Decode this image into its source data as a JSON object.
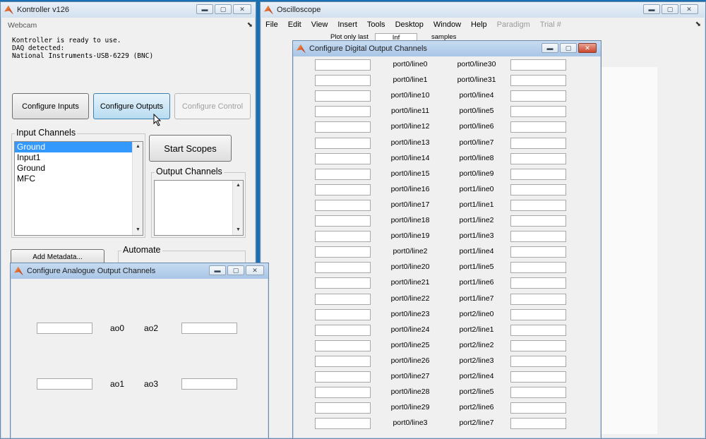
{
  "kontroller": {
    "title": "Kontroller v126",
    "menu_label": "Webcam",
    "pin_glyph": "⬊",
    "messages": [
      "Kontroller is ready to use.",
      "DAQ detected:",
      "National Instruments-USB-6229 (BNC)"
    ],
    "buttons": {
      "configure_inputs": "Configure Inputs",
      "configure_outputs": "Configure Outputs",
      "configure_control": "Configure Control",
      "start_scopes": "Start Scopes",
      "add_metadata": "Add Metadata..."
    },
    "input_channels": {
      "title": "Input Channels",
      "items": [
        "Ground",
        "Input1",
        "Ground",
        "MFC"
      ]
    },
    "output_channels": {
      "title": "Output Channels"
    },
    "automate": {
      "title": "Automate"
    }
  },
  "oscilloscope": {
    "title": "Oscilloscope",
    "menu": [
      "File",
      "Edit",
      "View",
      "Insert",
      "Tools",
      "Desktop",
      "Window",
      "Help"
    ],
    "menu_disabled": [
      "Paradigm",
      "Trial #"
    ],
    "pin_glyph": "⬊",
    "plot_only_last_label": "Plot only last",
    "plot_only_last_value": "Inf",
    "samples_label": "samples"
  },
  "analogue_output": {
    "title": "Configure Analogue Output Channels",
    "rows": [
      {
        "left_label": "ao0",
        "right_label": "ao2"
      },
      {
        "left_label": "ao1",
        "right_label": "ao3"
      }
    ]
  },
  "digital_output": {
    "title": "Configure Digital Output Channels",
    "rows": [
      {
        "left": "port0/line0",
        "right": "port0/line30"
      },
      {
        "left": "port0/line1",
        "right": "port0/line31"
      },
      {
        "left": "port0/line10",
        "right": "port0/line4"
      },
      {
        "left": "port0/line11",
        "right": "port0/line5"
      },
      {
        "left": "port0/line12",
        "right": "port0/line6"
      },
      {
        "left": "port0/line13",
        "right": "port0/line7"
      },
      {
        "left": "port0/line14",
        "right": "port0/line8"
      },
      {
        "left": "port0/line15",
        "right": "port0/line9"
      },
      {
        "left": "port0/line16",
        "right": "port1/line0"
      },
      {
        "left": "port0/line17",
        "right": "port1/line1"
      },
      {
        "left": "port0/line18",
        "right": "port1/line2"
      },
      {
        "left": "port0/line19",
        "right": "port1/line3"
      },
      {
        "left": "port0/line2",
        "right": "port1/line4"
      },
      {
        "left": "port0/line20",
        "right": "port1/line5"
      },
      {
        "left": "port0/line21",
        "right": "port1/line6"
      },
      {
        "left": "port0/line22",
        "right": "port1/line7"
      },
      {
        "left": "port0/line23",
        "right": "port2/line0"
      },
      {
        "left": "port0/line24",
        "right": "port2/line1"
      },
      {
        "left": "port0/line25",
        "right": "port2/line2"
      },
      {
        "left": "port0/line26",
        "right": "port2/line3"
      },
      {
        "left": "port0/line27",
        "right": "port2/line4"
      },
      {
        "left": "port0/line28",
        "right": "port2/line5"
      },
      {
        "left": "port0/line29",
        "right": "port2/line6"
      },
      {
        "left": "port0/line3",
        "right": "port2/line7"
      }
    ]
  },
  "window_controls": {
    "minimize": "▬",
    "maximize": "▢",
    "close": "✕"
  }
}
